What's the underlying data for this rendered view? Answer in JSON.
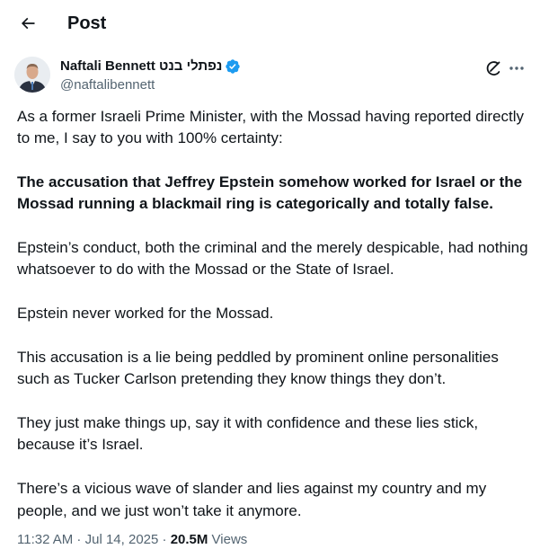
{
  "header": {
    "title": "Post",
    "back_icon": "arrow-left-icon"
  },
  "author": {
    "display_name": "Naftali Bennett נפתלי בנט",
    "handle": "@naftalibennett",
    "verified": true,
    "verified_color": "#1d9bf0",
    "avatar_icon": "user-avatar"
  },
  "actions": {
    "grok_icon": "grok-icon",
    "more_icon": "more-horizontal-icon"
  },
  "tweet": {
    "paragraphs": [
      {
        "text": "As a former Israeli Prime Minister, with the Mossad having reported directly to me, I say to you with 100% certainty:",
        "bold": false
      },
      {
        "text": "The accusation that Jeffrey Epstein somehow worked for Israel or the Mossad running a blackmail ring is categorically and totally false.",
        "bold": true
      },
      {
        "text": "Epstein’s conduct, both the criminal and the merely despicable, had nothing whatsoever to do with the Mossad or the State of Israel.",
        "bold": false
      },
      {
        "text": "Epstein never worked for the Mossad.",
        "bold": false
      },
      {
        "text": "This accusation is a lie being peddled by prominent online personalities such as Tucker Carlson pretending they know things they don’t.",
        "bold": false
      },
      {
        "text": "They just make things up, say it with confidence and these lies stick, because it’s Israel.",
        "bold": false
      },
      {
        "text": "There’s a vicious wave of slander and lies against my country and my people, and we just won’t take it anymore.",
        "bold": false
      }
    ]
  },
  "meta": {
    "time": "11:32 AM",
    "separator": " · ",
    "date": "Jul 14, 2025",
    "views_count": "20.5M",
    "views_label": " Views"
  },
  "colors": {
    "text": "#0f1419",
    "secondary": "#536471",
    "accent": "#1d9bf0"
  }
}
